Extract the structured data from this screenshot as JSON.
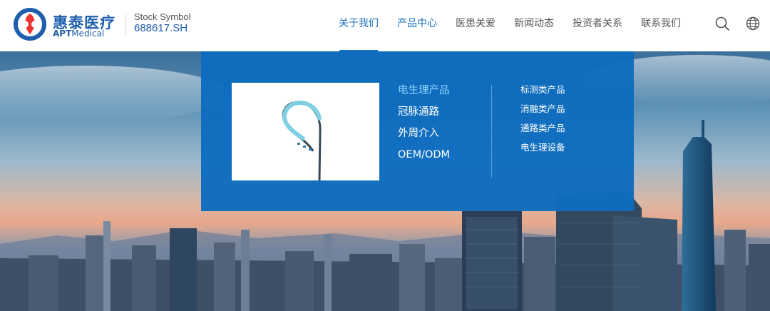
{
  "brand": {
    "name_cn": "惠泰医疗",
    "name_en_bold": "APT",
    "name_en_rest": "Medical",
    "stock_label": "Stock Symbol",
    "stock_code": "688617.SH",
    "primary_color": "#1f5fae",
    "accent_red": "#e8342c"
  },
  "nav": {
    "items": [
      {
        "label": "关于我们",
        "state": "active"
      },
      {
        "label": "产品中心",
        "state": "hover"
      },
      {
        "label": "医患关爱",
        "state": ""
      },
      {
        "label": "新闻动态",
        "state": ""
      },
      {
        "label": "投资者关系",
        "state": ""
      },
      {
        "label": "联系我们",
        "state": ""
      }
    ],
    "icons": [
      "search-icon",
      "globe-icon"
    ]
  },
  "dropdown": {
    "background": "#0e6cbe",
    "image_alt": "catheter-product-image",
    "categories": [
      {
        "label": "电生理产品",
        "current": true
      },
      {
        "label": "冠脉通路",
        "current": false
      },
      {
        "label": "外周介入",
        "current": false
      },
      {
        "label": "OEM/ODM",
        "current": false
      }
    ],
    "subcategories": [
      "标测类产品",
      "消融类产品",
      "通路类产品",
      "电生理设备"
    ]
  }
}
